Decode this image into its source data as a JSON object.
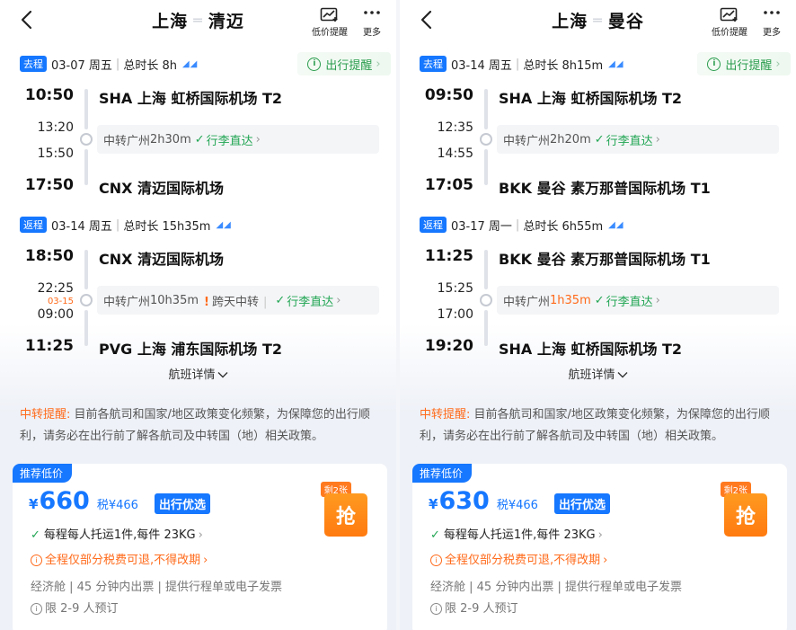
{
  "icons": {
    "back": "chevron-left-icon",
    "price_alert": "chart-trend-icon",
    "more": "more-dots-icon",
    "plane": "airline-logo-icon"
  },
  "colors": {
    "accent": "#1677ff",
    "success": "#22a654",
    "warning": "#ff6a1a"
  },
  "panels": [
    {
      "header": {
        "from": "上海",
        "to": "清迈",
        "price_alert": "低价提醒",
        "more": "更多"
      },
      "outbound": {
        "tag": "去程",
        "date": "03-07 周五",
        "duration": "总时长 8h",
        "remind": "出行提醒",
        "dep_time": "10:50",
        "dep_airport": "SHA  上海 虹桥国际机场 T2",
        "stop_arr": "13:20",
        "stop_dep": "15:50",
        "stop_next": "",
        "transfer": "中转广州 ",
        "transfer_time": "2h30m",
        "transfer_time_warn": "",
        "overnight": "",
        "baggage": "行李直达",
        "arr_time": "17:50",
        "arr_airport": "CNX  清迈国际机场"
      },
      "return": {
        "tag": "返程",
        "date": "03-14 周五",
        "duration": "总时长 15h35m",
        "dep_time": "18:50",
        "dep_airport": "CNX  清迈国际机场",
        "stop_arr": "22:25",
        "stop_dep": "09:00",
        "stop_next": "03-15",
        "transfer": "中转广州 ",
        "transfer_time": "10h35m",
        "transfer_time_warn": "",
        "overnight": "跨天中转",
        "baggage": "行李直达",
        "arr_time": "11:25",
        "arr_airport": "PVG  上海 浦东国际机场 T2"
      },
      "details": "航班详情",
      "notice": {
        "label": "中转提醒:",
        "text": " 目前各航司和国家/地区政策变化频繁，为保障您的出行顺利，请务必在出行前了解各航司及中转国（地）相关政策。"
      },
      "offer": {
        "tag": "推荐低价",
        "currency": "¥",
        "price": "660",
        "tax": "税¥466",
        "preferred": "出行优选",
        "remaining": "剩2张",
        "grab": "抢",
        "baggage": "每程每人托运1件,每件 23KG",
        "refund": "全程仅部分税费可退,不得改期",
        "info": "经济舱 | 45 分钟内出票 | 提供行程单或电子发票",
        "limit": "限 2-9 人预订"
      }
    },
    {
      "header": {
        "from": "上海",
        "to": "曼谷",
        "price_alert": "低价提醒",
        "more": "更多"
      },
      "outbound": {
        "tag": "去程",
        "date": "03-14 周五",
        "duration": "总时长 8h15m",
        "remind": "出行提醒",
        "dep_time": "09:50",
        "dep_airport": "SHA  上海 虹桥国际机场 T2",
        "stop_arr": "12:35",
        "stop_dep": "14:55",
        "stop_next": "",
        "transfer": "中转广州 ",
        "transfer_time": "2h20m",
        "transfer_time_warn": "",
        "overnight": "",
        "baggage": "行李直达",
        "arr_time": "17:05",
        "arr_airport": "BKK  曼谷 素万那普国际机场 T1"
      },
      "return": {
        "tag": "返程",
        "date": "03-17 周一",
        "duration": "总时长 6h55m",
        "dep_time": "11:25",
        "dep_airport": "BKK  曼谷 素万那普国际机场 T1",
        "stop_arr": "15:25",
        "stop_dep": "17:00",
        "stop_next": "",
        "transfer": "中转广州 ",
        "transfer_time": "",
        "transfer_time_warn": "1h35m",
        "overnight": "",
        "baggage": "行李直达",
        "arr_time": "19:20",
        "arr_airport": "SHA  上海 虹桥国际机场 T2"
      },
      "details": "航班详情",
      "notice": {
        "label": "中转提醒:",
        "text": " 目前各航司和国家/地区政策变化频繁，为保障您的出行顺利，请务必在出行前了解各航司及中转国（地）相关政策。"
      },
      "offer": {
        "tag": "推荐低价",
        "currency": "¥",
        "price": "630",
        "tax": "税¥466",
        "preferred": "出行优选",
        "remaining": "剩2张",
        "grab": "抢",
        "baggage": "每程每人托运1件,每件 23KG",
        "refund": "全程仅部分税费可退,不得改期",
        "info": "经济舱 | 45 分钟内出票 | 提供行程单或电子发票",
        "limit": "限 2-9 人预订"
      }
    }
  ]
}
